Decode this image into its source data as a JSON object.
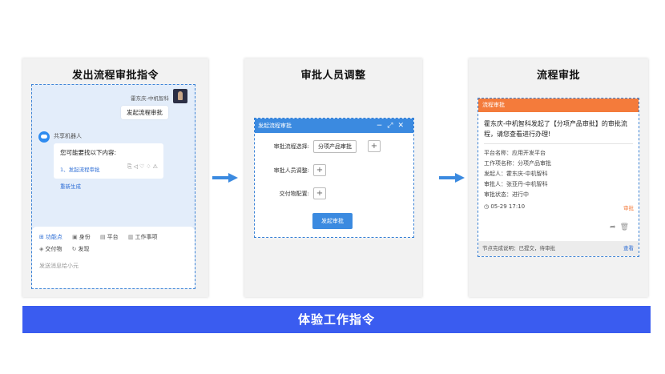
{
  "panels": {
    "send": {
      "title": "发出流程审批指令",
      "user_name": "霍东庆-中机智科",
      "user_message": "发起流程审批",
      "bot_name": "共享机器人",
      "bot_prompt": "您可能要找以下内容:",
      "bot_suggestion": "1、发起流程审批",
      "regenerate": "重新生成",
      "tools": [
        {
          "icon": "⊞",
          "label": "功能点"
        },
        {
          "icon": "▣",
          "label": "身份"
        },
        {
          "icon": "▤",
          "label": "平台"
        },
        {
          "icon": "▥",
          "label": "工作事项"
        },
        {
          "icon": "◈",
          "label": "交付物"
        },
        {
          "icon": "↻",
          "label": "发现"
        }
      ],
      "input_placeholder": "发送消息给小元"
    },
    "adjust": {
      "title": "审批人员调整",
      "dialog_title": "发起流程审批",
      "labels": [
        "审批流程选择:",
        "审批人员调整:",
        "交付物配置:"
      ],
      "selected_flow": "分项产品审批",
      "plus": "+",
      "submit": "发起审批"
    },
    "approve": {
      "title": "流程审批",
      "card_title": "流程审批",
      "message": "霍东庆-中机智科发起了【分项产品审批】的审批流程，请您查看进行办理!",
      "fields": [
        "平台名称：应用开发平台",
        "工作项名称：分项产品审批",
        "发起人：霍东庆-中机智科",
        "审批人：张亚丹-中机智科",
        "审批状态：进行中"
      ],
      "time": "05-29 17:10",
      "approve_tag": "审批",
      "footer": "节点完成说明：已提交，待审批",
      "view": "查看"
    }
  },
  "bottom_bar": "体验工作指令",
  "colors": {
    "accent_blue": "#3a5cf0",
    "dialog_blue": "#3b8ae0",
    "card_orange": "#f47b3b",
    "arrow_blue": "#3b8ae0"
  }
}
